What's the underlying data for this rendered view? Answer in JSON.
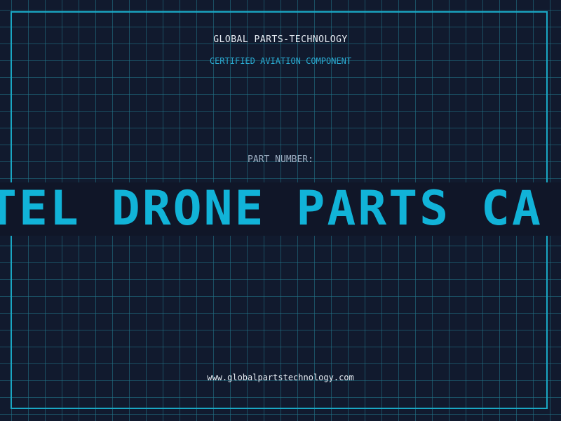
{
  "brand": "GLOBAL PARTS-TECHNOLOGY",
  "subtitle": "CERTIFIED AVIATION COMPONENT",
  "part_label": "PART NUMBER:",
  "banner_text": "TEL DRONE PARTS CA",
  "url": "www.globalpartstechnology.com",
  "colors": {
    "background": "#111a2e",
    "grid": "#22788c",
    "frame": "#1aa7c4",
    "accent": "#11b3d8",
    "text": "#e8eef5",
    "muted": "#9fb0c4"
  }
}
